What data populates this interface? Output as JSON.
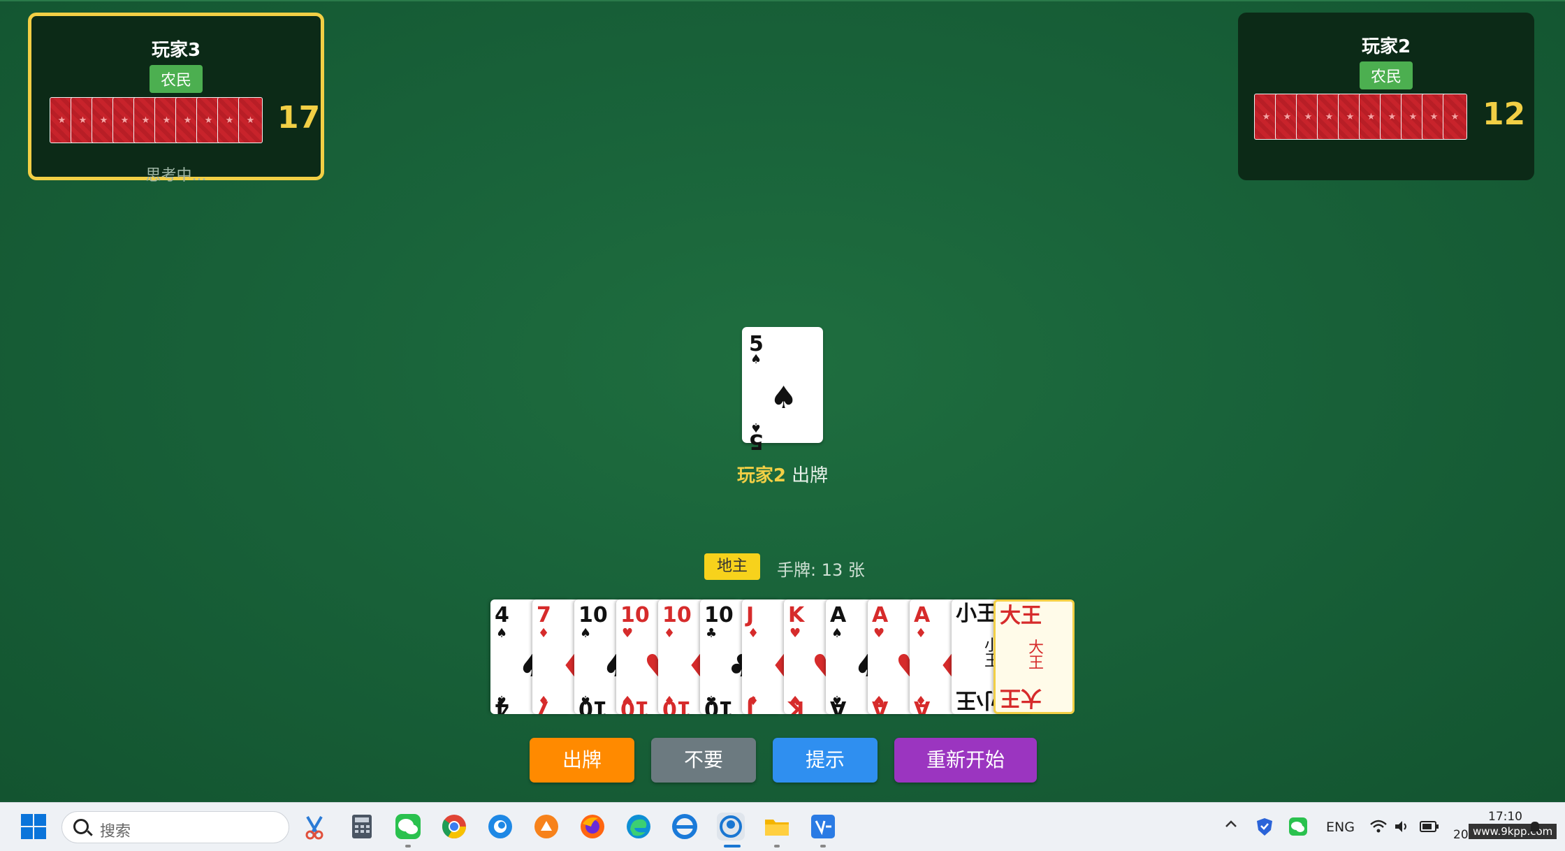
{
  "players": {
    "left": {
      "name": "玩家3",
      "role": "农民",
      "card_count": "17",
      "status": "思考中..."
    },
    "right": {
      "name": "玩家2",
      "role": "农民",
      "card_count": "12",
      "status": ""
    }
  },
  "card_back_symbol": "★",
  "table": {
    "played_card": {
      "rank": "5",
      "suit": "♠",
      "color": "black"
    },
    "caption_player": "玩家2",
    "caption_action": "出牌"
  },
  "self": {
    "role": "地主",
    "hand_label": "手牌: 13 张",
    "hand": [
      {
        "rank": "4",
        "suit": "♠",
        "color": "black"
      },
      {
        "rank": "7",
        "suit": "♦",
        "color": "red"
      },
      {
        "rank": "10",
        "suit": "♠",
        "color": "black"
      },
      {
        "rank": "10",
        "suit": "♥",
        "color": "red"
      },
      {
        "rank": "10",
        "suit": "♦",
        "color": "red"
      },
      {
        "rank": "10",
        "suit": "♣",
        "color": "black"
      },
      {
        "rank": "J",
        "suit": "♦",
        "color": "red"
      },
      {
        "rank": "K",
        "suit": "♥",
        "color": "red"
      },
      {
        "rank": "A",
        "suit": "♠",
        "color": "black"
      },
      {
        "rank": "A",
        "suit": "♥",
        "color": "red"
      },
      {
        "rank": "A",
        "suit": "♦",
        "color": "red"
      },
      {
        "rank": "小王",
        "suit": "",
        "color": "black",
        "joker": "small"
      },
      {
        "rank": "大王",
        "suit": "",
        "color": "red",
        "joker": "big"
      }
    ]
  },
  "buttons": {
    "play": "出牌",
    "pass": "不要",
    "hint": "提示",
    "restart": "重新开始"
  },
  "colors": {
    "play": "#ff8a00",
    "pass": "#6c7a80",
    "hint": "#2f8ff0",
    "restart": "#9b35c0",
    "highlight": "#f2cf45"
  },
  "taskbar": {
    "search_placeholder": "搜索",
    "lang": "ENG",
    "time": "17:10",
    "date": "2025",
    "watermark": "www.9kpp.com"
  }
}
